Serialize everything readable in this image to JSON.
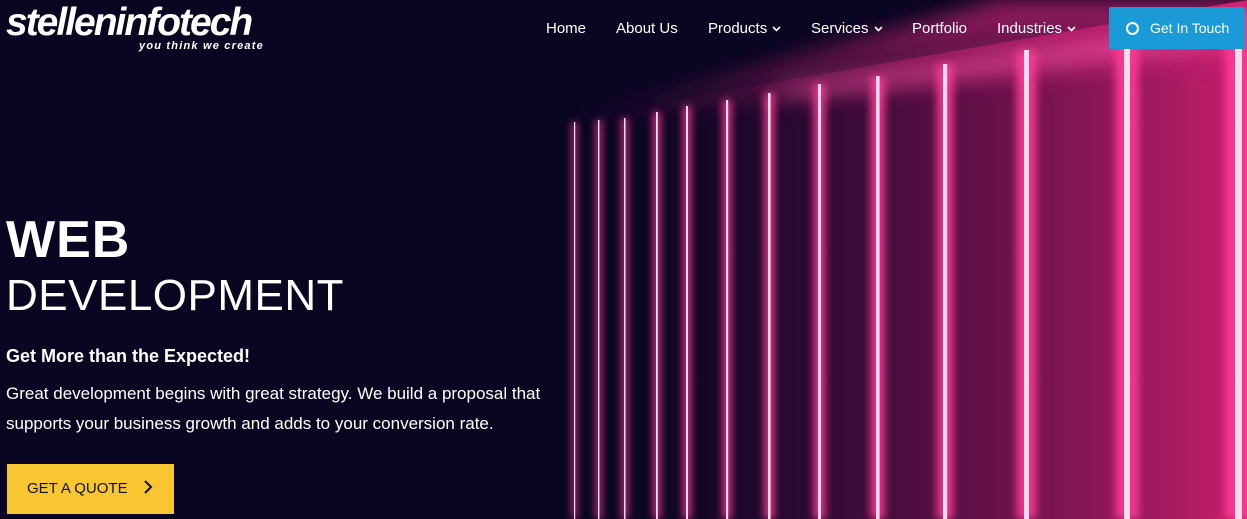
{
  "brand": {
    "name": "stelleninfotech",
    "tagline": "you think we create"
  },
  "nav": {
    "items": [
      {
        "label": "Home",
        "has_dropdown": false
      },
      {
        "label": "About Us",
        "has_dropdown": false
      },
      {
        "label": "Products",
        "has_dropdown": true
      },
      {
        "label": "Services",
        "has_dropdown": true
      },
      {
        "label": "Portfolio",
        "has_dropdown": false
      },
      {
        "label": "Industries",
        "has_dropdown": true
      }
    ],
    "cta_label": "Get In Touch"
  },
  "hero": {
    "headline_line1": "WEB",
    "headline_line2": "DEVELOPMENT",
    "subheading": "Get More than the Expected!",
    "body_line1": "Great development begins with great strategy. We build a proposal that",
    "body_line2": "supports your business growth and adds to your conversion rate.",
    "button_label": "GET A QUOTE"
  },
  "colors": {
    "background": "#080621",
    "accent_magenta": "#c8206e",
    "cta_blue": "#1a9ad6",
    "button_yellow": "#f8c630",
    "text": "#ffffff"
  }
}
